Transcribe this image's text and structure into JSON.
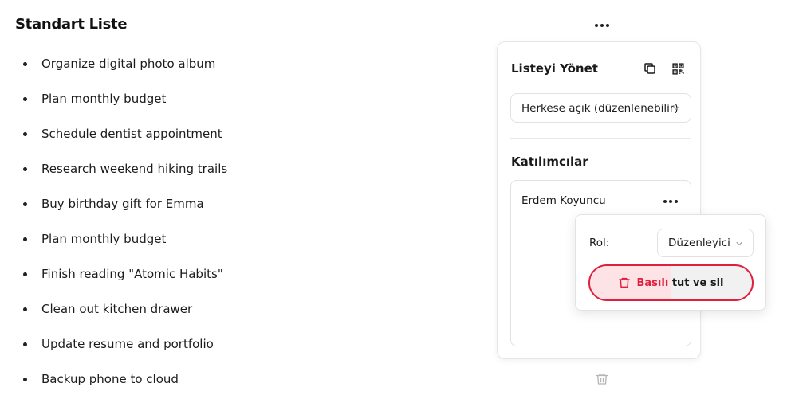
{
  "header": {
    "title": "Standart Liste",
    "more_icon": "more-horizontal-icon"
  },
  "tasks": [
    "Organize digital photo album",
    "Plan monthly budget",
    "Schedule dentist appointment",
    "Research weekend hiking trails",
    "Buy birthday gift for Emma",
    "Plan monthly budget",
    "Finish reading \"Atomic Habits\"",
    "Clean out kitchen drawer",
    "Update resume and portfolio",
    "Backup phone to cloud"
  ],
  "manage_panel": {
    "title": "Listeyi Yönet",
    "copy_icon": "copy-icon",
    "qr_icon": "qr-code-icon",
    "access_value": "Herkese açık (düzenlenebilir)",
    "participants_title": "Katılımcılar",
    "participants": [
      {
        "name": "Erdem Koyuncu"
      }
    ]
  },
  "role_popover": {
    "role_label": "Rol:",
    "role_value": "Düzenleyici",
    "delete_label_highlight": "Basılı",
    "delete_label_rest": "tut ve sil",
    "delete_hold_progress": 0.5
  },
  "colors": {
    "danger": "#e01f3d",
    "danger_light": "#fde3e6",
    "text": "#1a1a1a",
    "border": "#e2e2e2"
  }
}
